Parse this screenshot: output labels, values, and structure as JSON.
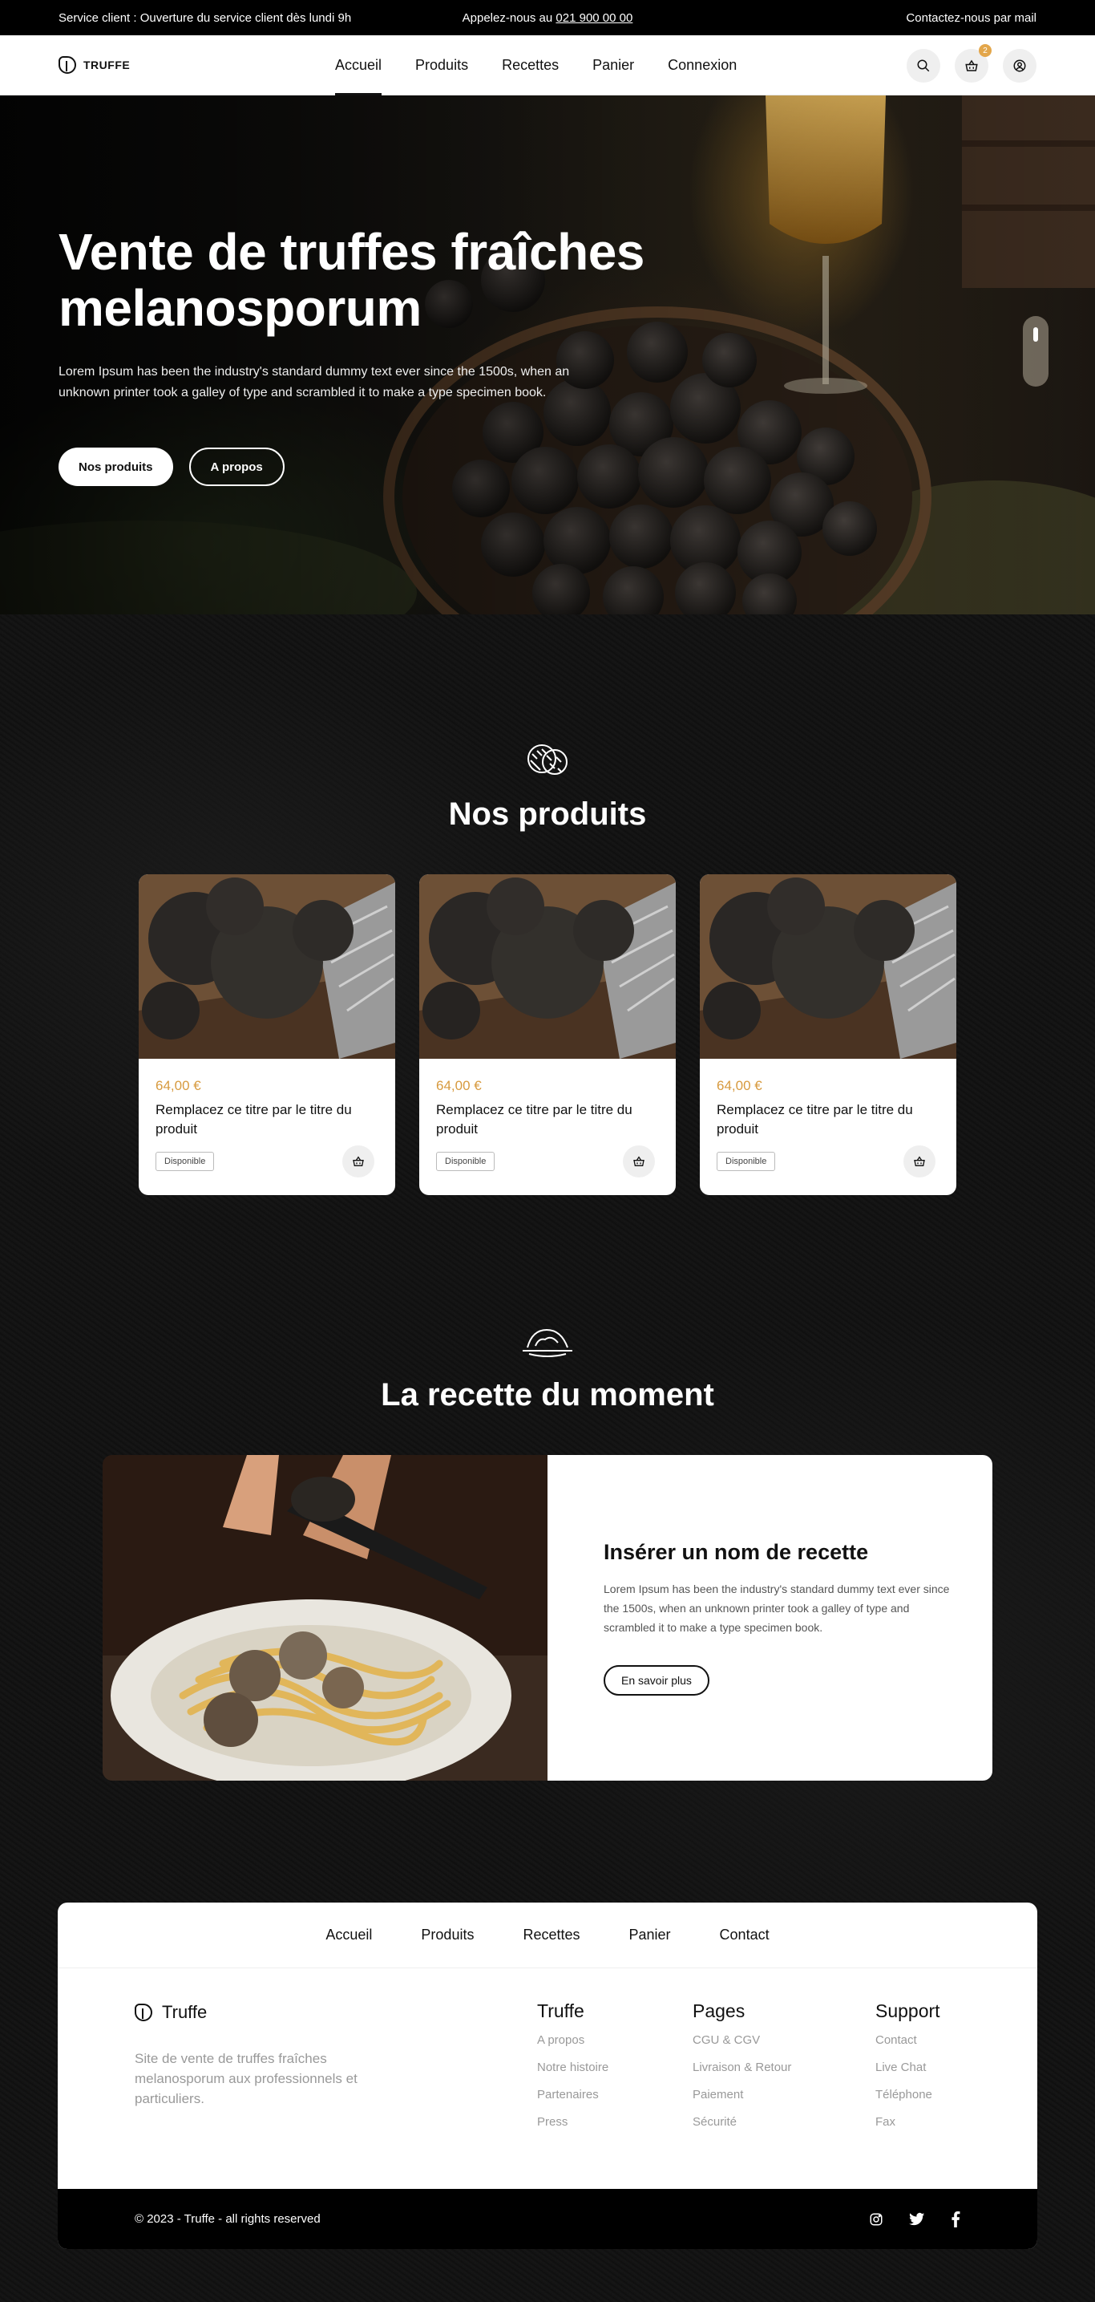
{
  "topbar": {
    "service": "Service client : Ouverture du service client dès lundi 9h",
    "call_prefix": "Appelez-nous au",
    "phone": "021 900 00 00",
    "mail": "Contactez-nous par mail"
  },
  "nav": {
    "logo": "TRUFFE",
    "links": [
      "Accueil",
      "Produits",
      "Recettes",
      "Panier",
      "Connexion"
    ],
    "active": "Accueil",
    "cart_count": "2"
  },
  "hero": {
    "title_line1": "Vente de truffes fraîches",
    "title_line2": "melanosporum",
    "text": "Lorem Ipsum has been the industry's standard dummy text ever since the 1500s, when an unknown printer took a galley of type and scrambled it to make a type specimen book.",
    "btn_primary": "Nos produits",
    "btn_secondary": "A propos"
  },
  "products_section": {
    "title": "Nos produits",
    "items": [
      {
        "price": "64,00 €",
        "title": "Remplacez ce titre par le titre du produit",
        "tag": "Disponible"
      },
      {
        "price": "64,00 €",
        "title": "Remplacez ce titre par le titre du produit",
        "tag": "Disponible"
      },
      {
        "price": "64,00 €",
        "title": "Remplacez ce titre par le titre du produit",
        "tag": "Disponible"
      }
    ]
  },
  "recipe_section": {
    "title": "La recette du moment",
    "recipe_title": "Insérer un nom de recette",
    "recipe_text": "Lorem Ipsum has been the industry's standard dummy text ever since the 1500s, when an unknown printer took a galley of type and scrambled it to make a type specimen book.",
    "button": "En savoir plus"
  },
  "footer": {
    "nav": [
      "Accueil",
      "Produits",
      "Recettes",
      "Panier",
      "Contact"
    ],
    "brand": "Truffe",
    "description": "Site de vente de truffes fraîches melanosporum aux professionnels et particuliers.",
    "columns": [
      {
        "title": "Truffe",
        "links": [
          "A propos",
          "Notre histoire",
          "Partenaires",
          "Press"
        ]
      },
      {
        "title": "Pages",
        "links": [
          "CGU & CGV",
          "Livraison & Retour",
          "Paiement",
          "Sécurité"
        ]
      },
      {
        "title": "Support",
        "links": [
          "Contact",
          "Live Chat",
          "Téléphone",
          "Fax"
        ]
      }
    ],
    "copyright": "© 2023 - Truffe - all rights reserved",
    "socials": [
      "instagram-icon",
      "twitter-icon",
      "facebook-icon"
    ]
  },
  "colors": {
    "accent_price": "#d79a3e",
    "badge": "#e3a64a",
    "dark_bg": "#111111"
  }
}
